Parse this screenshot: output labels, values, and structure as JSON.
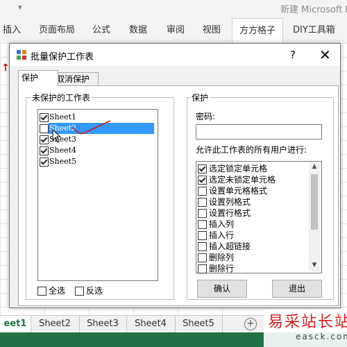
{
  "excel": {
    "title": "新建 Microsoft E",
    "ribbon_tabs": [
      "插入",
      "页面布局",
      "公式",
      "数据",
      "审阅",
      "视图",
      "方方格子",
      "DIY工具箱"
    ],
    "sheet_tabs": [
      "eet1",
      "Sheet2",
      "Sheet3",
      "Sheet4",
      "Sheet5"
    ],
    "add_sheet": "+",
    "status_color": "#217346"
  },
  "dialog": {
    "title": "批量保护工作表",
    "help": "?",
    "close": "✕",
    "tabs": {
      "protect": "保护",
      "unprotect": "取消保护"
    },
    "unprotected_group": {
      "label": "未保护的工作表",
      "sheets": [
        {
          "name": "Sheet1",
          "checked": true
        },
        {
          "name": "Sheet2",
          "checked": false,
          "selected": true
        },
        {
          "name": "Sheet3",
          "checked": true
        },
        {
          "name": "Sheet4",
          "checked": true
        },
        {
          "name": "Sheet5",
          "checked": true
        }
      ],
      "select_all": "全选",
      "invert": "反选"
    },
    "protect_group": {
      "label": "保护",
      "password_label": "密码:",
      "password_value": "",
      "allow_label": "允许此工作表的所有用户进行:",
      "permissions": [
        {
          "name": "选定锁定单元格",
          "checked": true
        },
        {
          "name": "选定未锁定单元格",
          "checked": true
        },
        {
          "name": "设置单元格格式",
          "checked": false
        },
        {
          "name": "设置列格式",
          "checked": false
        },
        {
          "name": "设置行格式",
          "checked": false
        },
        {
          "name": "插入列",
          "checked": false
        },
        {
          "name": "插入行",
          "checked": false
        },
        {
          "name": "插入超链接",
          "checked": false
        },
        {
          "name": "删除列",
          "checked": false
        },
        {
          "name": "删除行",
          "checked": false
        }
      ],
      "ok": "确认",
      "exit": "退出"
    }
  },
  "watermark": {
    "text": "易采站长站",
    "url": "easck.com"
  }
}
